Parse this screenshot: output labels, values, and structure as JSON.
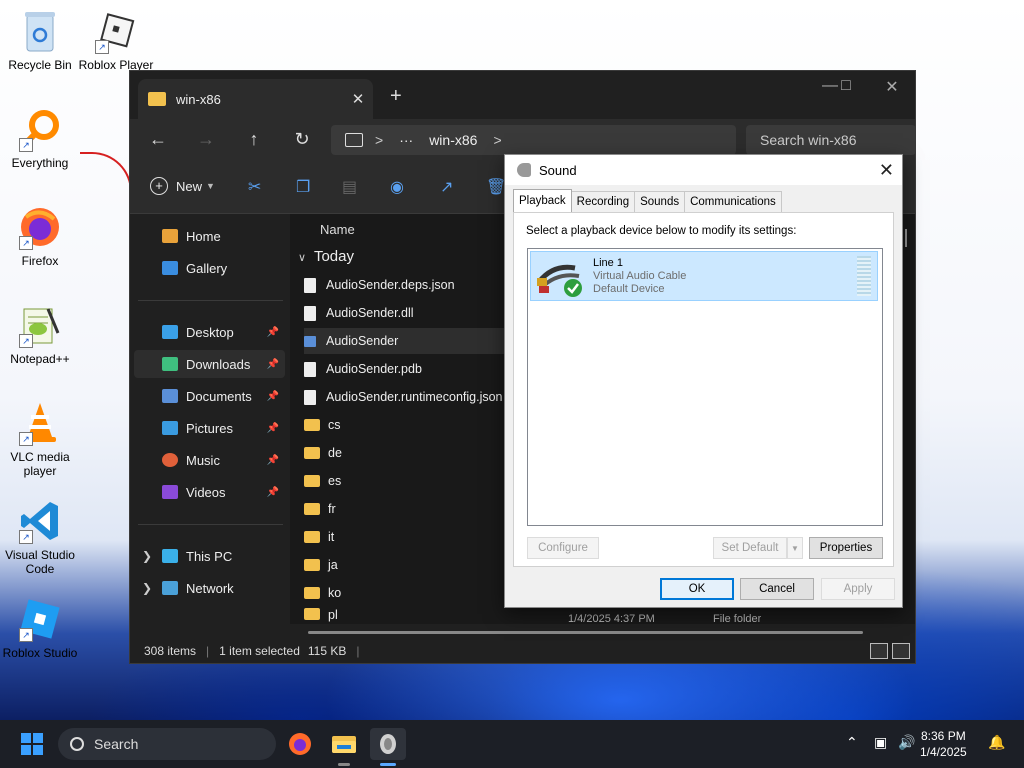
{
  "desktop": {
    "icons": [
      {
        "label": "Recycle Bin"
      },
      {
        "label": "Roblox Player"
      },
      {
        "label": "Everything"
      },
      {
        "label": "Firefox"
      },
      {
        "label": "Notepad++"
      },
      {
        "label": "VLC media player"
      },
      {
        "label": "Visual Studio Code"
      },
      {
        "label": "Roblox Studio"
      }
    ]
  },
  "explorer": {
    "tab_title": "win-x86",
    "tab_close": "✕",
    "new_tab": "+",
    "address": {
      "ellipsis": "···",
      "crumb": "win-x86",
      "chevron": ">"
    },
    "search_placeholder": "Search win-x86",
    "toolbar": {
      "new_label": "New"
    },
    "sidebar": {
      "home": "Home",
      "gallery": "Gallery",
      "desktop": "Desktop",
      "downloads": "Downloads",
      "documents": "Documents",
      "pictures": "Pictures",
      "music": "Music",
      "videos": "Videos",
      "this_pc": "This PC",
      "network": "Network"
    },
    "column_name": "Name",
    "group": "Today",
    "files": [
      "AudioSender.deps.json",
      "AudioSender.dll",
      "AudioSender",
      "AudioSender.pdb",
      "AudioSender.runtimeconfig.json"
    ],
    "folders": [
      "cs",
      "de",
      "es",
      "fr",
      "it",
      "ja",
      "ko",
      "pl"
    ],
    "partial_row": {
      "date": "1/4/2025 4:37 PM",
      "type": "File folder"
    },
    "status": {
      "items": "308 items",
      "selected": "1 item selected",
      "size": "115 KB"
    }
  },
  "sound_dialog": {
    "title": "Sound",
    "tabs": [
      "Playback",
      "Recording",
      "Sounds",
      "Communications"
    ],
    "instruction": "Select a playback device below to modify its settings:",
    "device": {
      "name": "Line 1",
      "desc": "Virtual Audio Cable",
      "status": "Default Device"
    },
    "buttons": {
      "configure": "Configure",
      "set_default": "Set Default",
      "properties": "Properties",
      "ok": "OK",
      "cancel": "Cancel",
      "apply": "Apply"
    }
  },
  "taskbar": {
    "search_label": "Search",
    "time": "8:36 PM",
    "date": "1/4/2025"
  },
  "colors": {
    "accent": "#0078d7",
    "folder": "#f2c14e",
    "selection": "#cce8ff"
  }
}
